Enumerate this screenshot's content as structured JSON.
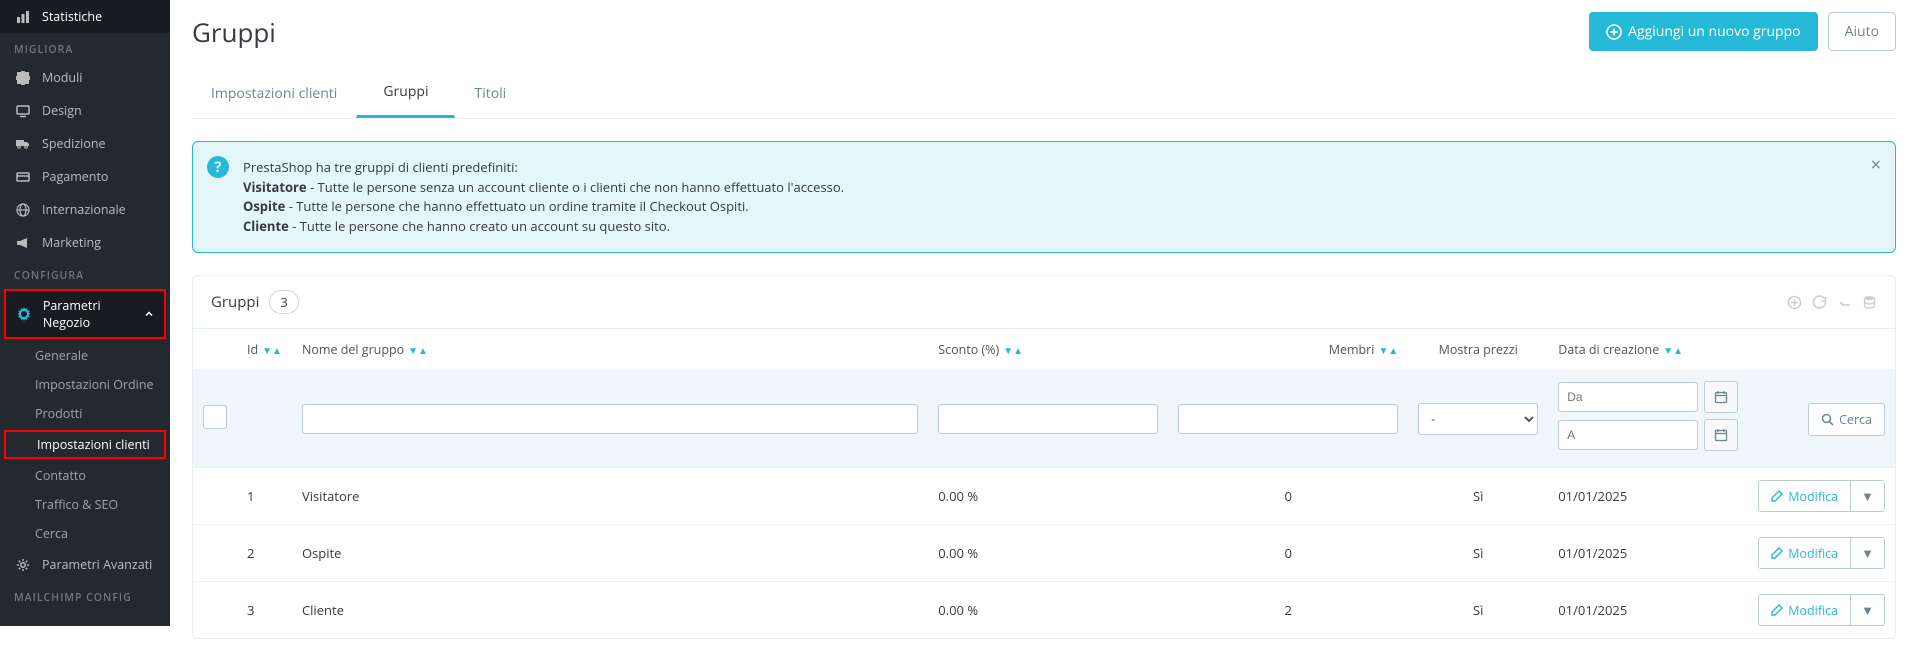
{
  "sidebar": {
    "stats": "Statistiche",
    "section_improve": "MIGLIORA",
    "moduli": "Moduli",
    "design": "Design",
    "spedizione": "Spedizione",
    "pagamento": "Pagamento",
    "internazionale": "Internazionale",
    "marketing": "Marketing",
    "section_configure": "CONFIGURA",
    "parametri_negozio": "Parametri Negozio",
    "sub": {
      "generale": "Generale",
      "impostazioni_ordine": "Impostazioni Ordine",
      "prodotti": "Prodotti",
      "impostazioni_clienti": "Impostazioni clienti",
      "contatto": "Contatto",
      "traffico_seo": "Traffico & SEO",
      "cerca": "Cerca"
    },
    "parametri_avanzati": "Parametri Avanzati",
    "section_mailchimp": "MAILCHIMP CONFIG"
  },
  "page": {
    "title": "Gruppi",
    "add_button": "Aggiungi un nuovo gruppo",
    "help_button": "Aiuto"
  },
  "tabs": {
    "clienti": "Impostazioni clienti",
    "gruppi": "Gruppi",
    "titoli": "Titoli"
  },
  "alert": {
    "line1": "PrestaShop ha tre gruppi di clienti predefiniti:",
    "b1": "Visitatore",
    "l1": " - Tutte le persone senza un account cliente o i clienti che non hanno effettuato l'accesso.",
    "b2": "Ospite",
    "l2": " - Tutte le persone che hanno effettuato un ordine tramite il Checkout Ospiti.",
    "b3": "Cliente",
    "l3": " - Tutte le persone che hanno creato un account su questo sito."
  },
  "panel": {
    "title": "Gruppi",
    "count": "3"
  },
  "columns": {
    "id": "Id",
    "name": "Nome del gruppo",
    "discount": "Sconto (%)",
    "members": "Membri",
    "show_prices": "Mostra prezzi",
    "created": "Data di creazione"
  },
  "filters": {
    "select_default": "-",
    "date_from_ph": "Da",
    "date_to_ph": "A",
    "search_btn": "Cerca"
  },
  "rows": [
    {
      "id": "1",
      "name": "Visitatore",
      "discount": "0.00 %",
      "members": "0",
      "show_prices": "Sì",
      "created": "01/01/2025"
    },
    {
      "id": "2",
      "name": "Ospite",
      "discount": "0.00 %",
      "members": "0",
      "show_prices": "Sì",
      "created": "01/01/2025"
    },
    {
      "id": "3",
      "name": "Cliente",
      "discount": "0.00 %",
      "members": "2",
      "show_prices": "Sì",
      "created": "01/01/2025"
    }
  ],
  "row_actions": {
    "modify": "Modifica"
  }
}
